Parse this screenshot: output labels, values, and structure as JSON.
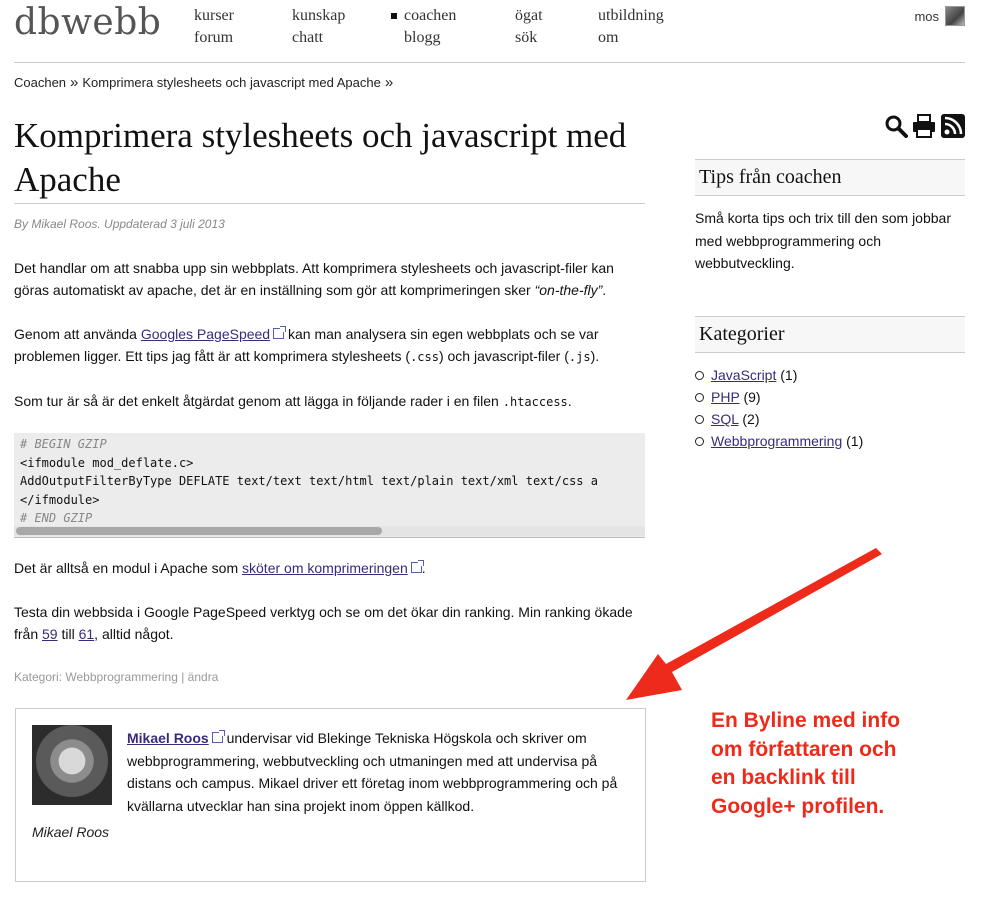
{
  "header": {
    "logo": "dbwebb",
    "nav": [
      {
        "label": "kurser"
      },
      {
        "label": "forum"
      },
      {
        "label": "kunskap"
      },
      {
        "label": "chatt"
      },
      {
        "label": "coachen",
        "active": true
      },
      {
        "label": "blogg"
      },
      {
        "label": "ögat"
      },
      {
        "label": "sök"
      },
      {
        "label": "utbildning"
      },
      {
        "label": "om"
      }
    ],
    "user": "mos"
  },
  "breadcrumb": {
    "items": [
      "Coachen",
      "Komprimera stylesheets och javascript med Apache"
    ],
    "separator": "»"
  },
  "article": {
    "title": "Komprimera stylesheets och javascript med Apache",
    "meta": "By Mikael Roos. Uppdaterad 3 juli 2013",
    "p1_a": "Det handlar om att snabba upp sin webbplats. Att komprimera stylesheets och javascript-filer kan göras automatiskt av apache, det är en inställning som gör att komprimeringen sker ",
    "p1_em": "“on-the-fly”",
    "p1_b": ".",
    "p2_a": "Genom att använda ",
    "p2_link": "Googles PageSpeed",
    "p2_b": " kan man analysera sin egen webbplats och se var problemen ligger. Ett tips jag fått är att komprimera stylesheets (",
    "p2_code1": ".css",
    "p2_c": ") och javascript-filer (",
    "p2_code2": ".js",
    "p2_d": ").",
    "p3_a": "Som tur är så är det enkelt åtgärdat genom att lägga in följande rader i en filen ",
    "p3_code": ".htaccess",
    "p3_b": ".",
    "code": [
      "# BEGIN GZIP",
      "<ifmodule mod_deflate.c>",
      "AddOutputFilterByType DEFLATE text/text text/html text/plain text/xml text/css a",
      "</ifmodule>",
      "# END GZIP"
    ],
    "p4_a": "Det är alltså en modul i Apache som ",
    "p4_link": "sköter om komprimeringen",
    "p4_b": ".",
    "p5_a": "Testa din webbsida i Google PageSpeed verktyg och se om det ökar din ranking. Min ranking ökade från ",
    "p5_link1": "59",
    "p5_b": " till ",
    "p5_link2": "61",
    "p5_c": ", alltid något.",
    "category_prefix": "Kategori: ",
    "category": "Webbprogrammering",
    "category_sep": " | ",
    "edit": "ändra"
  },
  "author": {
    "name": "Mikael Roos",
    "text": " undervisar vid Blekinge Tekniska Högskola och skriver om webbprogrammering, webbutveckling och utmaningen med att undervisa på distans och campus. Mikael driver ett företag inom webbprogrammering och på kvällarna utvecklar han sina projekt inom öppen källkod.",
    "signature": "Mikael Roos"
  },
  "sidebar": {
    "tips_title": "Tips från coachen",
    "tips_text": "Små korta tips och trix till den som jobbar med webbprogrammering och webbutveckling.",
    "categories_title": "Kategorier",
    "categories": [
      {
        "name": "JavaScript",
        "count": "(1)"
      },
      {
        "name": "PHP",
        "count": "(9)"
      },
      {
        "name": "SQL",
        "count": "(2)"
      },
      {
        "name": "Webbprogrammering",
        "count": "(1)"
      }
    ]
  },
  "annotation": {
    "lines": [
      "En Byline med info",
      "om författaren och",
      "en backlink till",
      "Google+ profilen."
    ],
    "color": "#ee2a1a"
  }
}
